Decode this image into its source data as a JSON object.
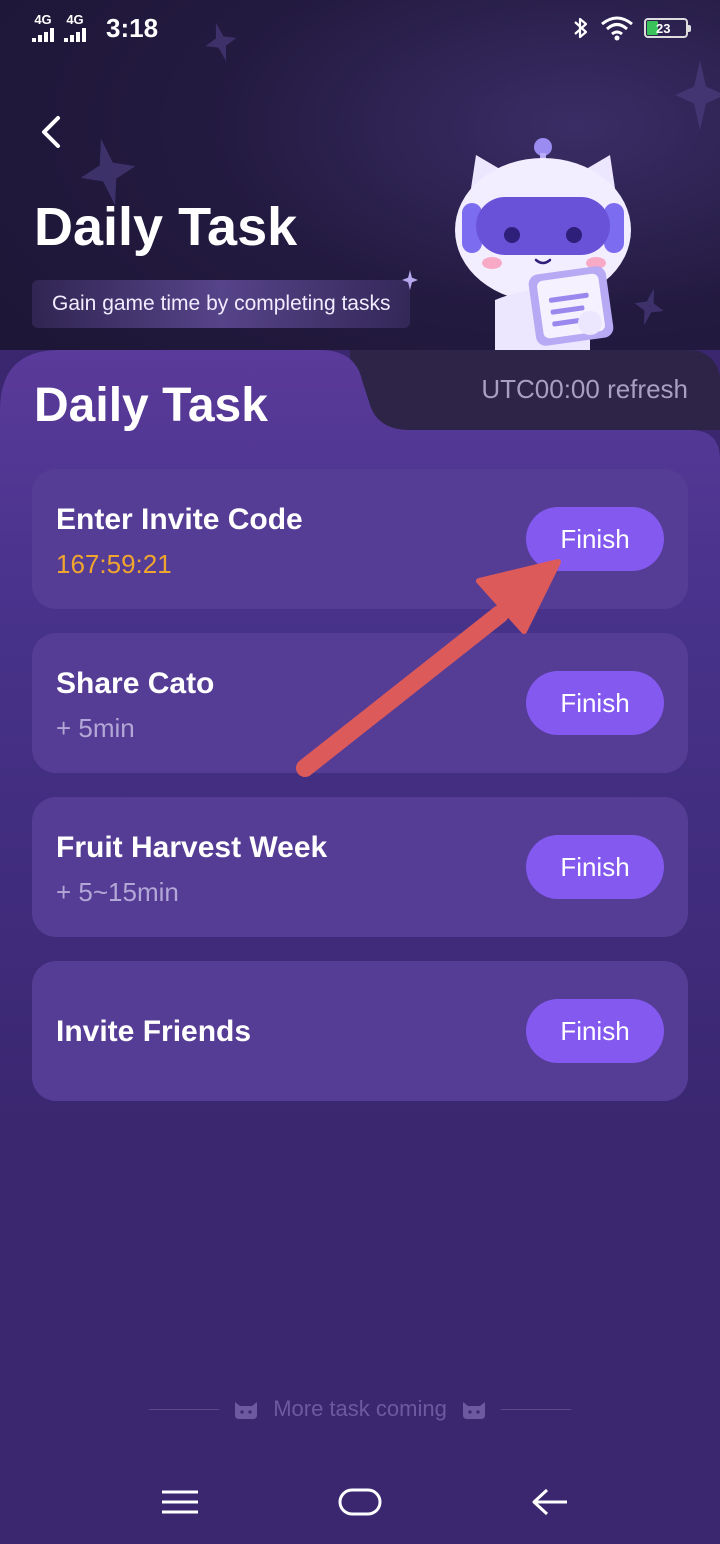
{
  "status_bar": {
    "network_1": "4G",
    "network_2": "4G",
    "time": "3:18",
    "battery_level": "23",
    "icons": [
      "bluetooth-icon",
      "wifi-icon",
      "battery-icon"
    ]
  },
  "header": {
    "title": "Daily Task",
    "subtitle": "Gain game time by completing tasks"
  },
  "panel": {
    "title": "Daily Task",
    "refresh_note": "UTC00:00 refresh"
  },
  "tasks": [
    {
      "name": "Enter Invite Code",
      "detail": "167:59:21",
      "button": "Finish"
    },
    {
      "name": "Share Cato",
      "detail": "+ 5min",
      "button": "Finish"
    },
    {
      "name": "Fruit Harvest Week",
      "detail": "+ 5~15min",
      "button": "Finish"
    },
    {
      "name": "Invite Friends",
      "detail": "",
      "button": "Finish"
    }
  ],
  "footer": {
    "more_text": "More task coming"
  },
  "colors": {
    "accent": "#8459f0",
    "timer": "#f0a52e",
    "annotation_arrow": "#dd5a5a",
    "card": "#553c95",
    "background": "#3a2770"
  }
}
